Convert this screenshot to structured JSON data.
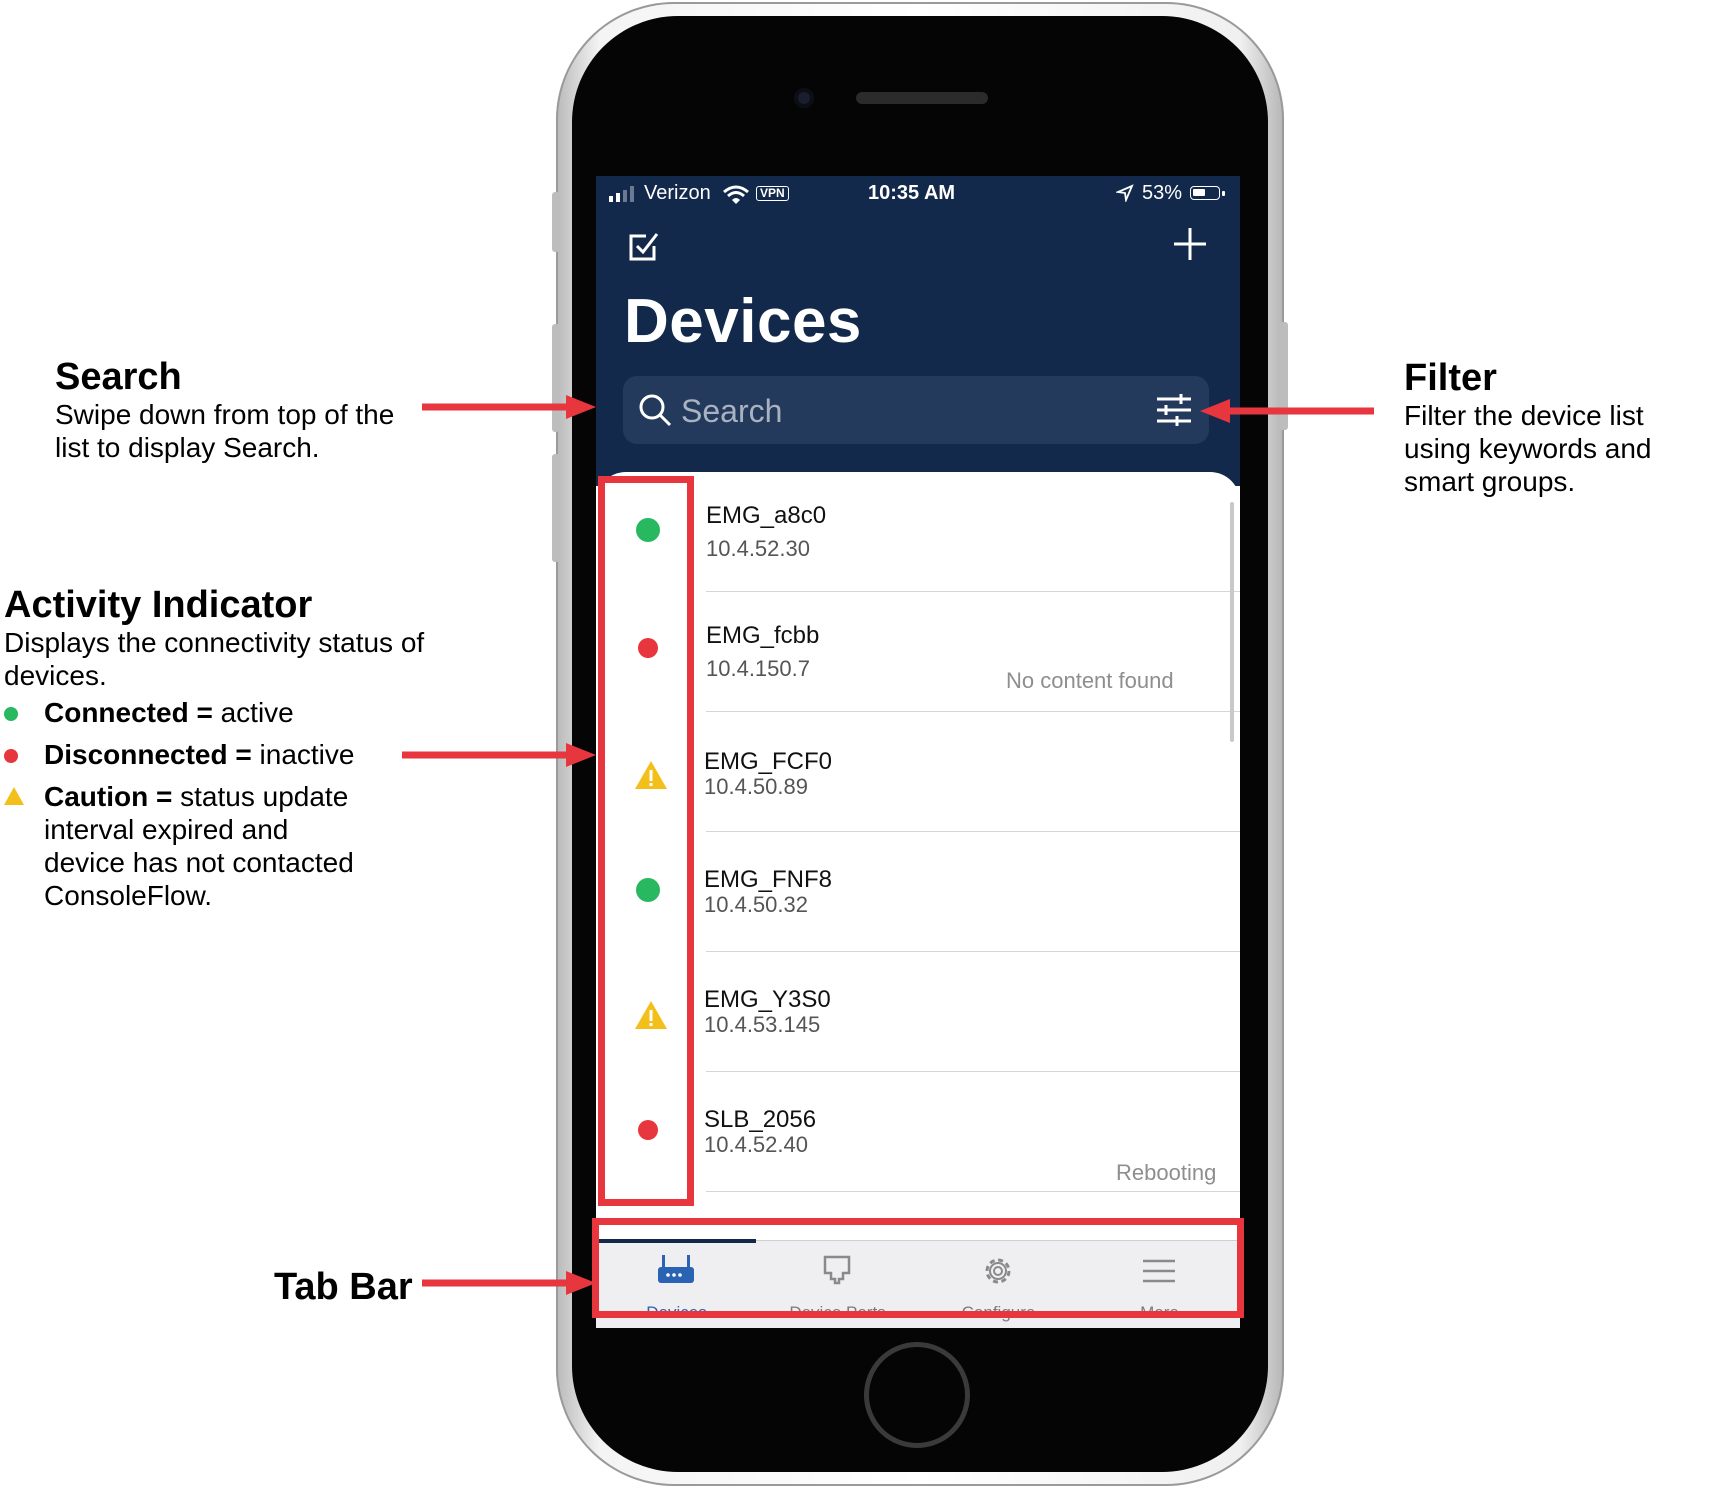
{
  "annotations": {
    "search": {
      "title": "Search",
      "lines": [
        "Swipe down from top of the",
        "list to display Search."
      ]
    },
    "filter": {
      "title": "Filter",
      "lines": [
        "Filter the device list",
        "using keywords and",
        "smart groups."
      ]
    },
    "activity": {
      "title": "Activity Indicator",
      "lines": [
        "Displays the connectivity status of",
        "devices."
      ],
      "legend": [
        {
          "key": "Connected",
          "sep": " = ",
          "value": "active",
          "color": "#27b860",
          "icon": "dot"
        },
        {
          "key": "Disconnected",
          "sep": " = ",
          "value": "inactive",
          "color": "#e8363f",
          "icon": "dot"
        },
        {
          "key": "Caution",
          "sep": " = ",
          "value": "status update",
          "extra": [
            "interval expired and",
            "device has not contacted",
            "ConsoleFlow."
          ],
          "color": "#f3c01b",
          "icon": "warning"
        }
      ]
    },
    "tabbar": {
      "title": "Tab Bar"
    }
  },
  "status_bar": {
    "carrier": "Verizon",
    "vpn": "VPN",
    "time": "10:35 AM",
    "battery": "53%",
    "battery_level": 0.53
  },
  "header": {
    "title": "Devices",
    "search_placeholder": "Search"
  },
  "devices": [
    {
      "name": "EMG_a8c0",
      "ip": "10.4.52.30",
      "status": "connected",
      "note": ""
    },
    {
      "name": "EMG_fcbb",
      "ip": "10.4.150.7",
      "status": "disconnected",
      "note": "No content found"
    },
    {
      "name": "EMG_FCF0",
      "ip": "10.4.50.89",
      "status": "caution",
      "note": ""
    },
    {
      "name": "EMG_FNF8",
      "ip": "10.4.50.32",
      "status": "connected",
      "note": ""
    },
    {
      "name": "EMG_Y3S0",
      "ip": "10.4.53.145",
      "status": "caution",
      "note": ""
    },
    {
      "name": "SLB_2056",
      "ip": "10.4.52.40",
      "status": "disconnected",
      "note": "Rebooting"
    }
  ],
  "tabs": [
    {
      "label": "Devices",
      "icon": "router-icon",
      "active": true
    },
    {
      "label": "Device Ports",
      "icon": "ethernet-port-icon",
      "active": false
    },
    {
      "label": "Configure",
      "icon": "gear-icon",
      "active": false
    },
    {
      "label": "More",
      "icon": "menu-icon",
      "active": false
    }
  ],
  "colors": {
    "header_bg": "#13294b",
    "connected": "#27b860",
    "disconnected": "#e8363f",
    "caution": "#f3c01b",
    "highlight": "#e8363f",
    "tab_active": "#2a63b3"
  }
}
